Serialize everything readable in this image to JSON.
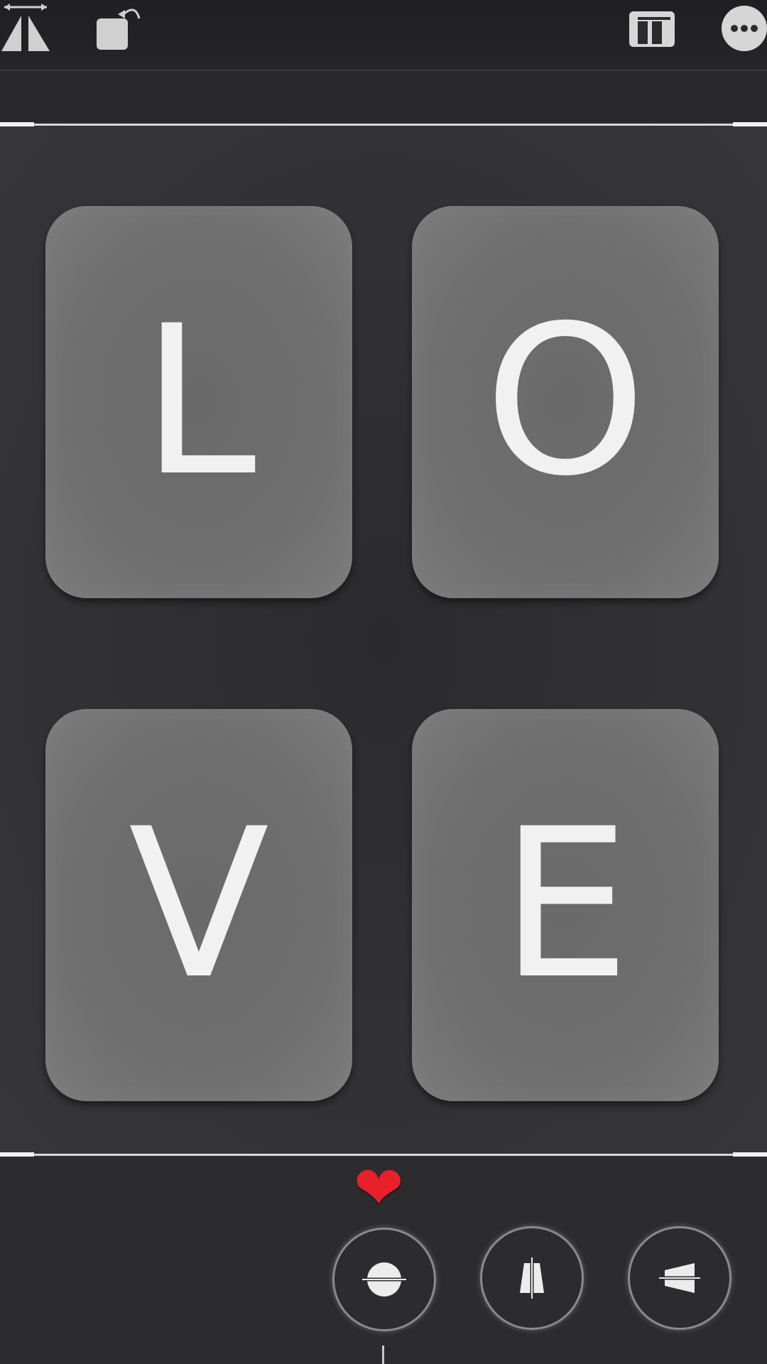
{
  "toolbar": {
    "left_tools": [
      {
        "icon": "flip-horizontal-icon"
      },
      {
        "icon": "rotate-icon"
      }
    ],
    "right_tools": [
      {
        "icon": "aspect-ratio-icon"
      },
      {
        "icon": "more-options-icon"
      }
    ]
  },
  "tiles": [
    {
      "letter": "L"
    },
    {
      "letter": "O"
    },
    {
      "letter": "V"
    },
    {
      "letter": "E"
    }
  ],
  "sticker": {
    "glyph": "❤"
  },
  "perspective_tools": [
    {
      "icon": "straighten-icon",
      "selected": true
    },
    {
      "icon": "vertical-perspective-icon",
      "selected": false
    },
    {
      "icon": "horizontal-perspective-icon",
      "selected": false
    }
  ],
  "colors": {
    "background": "#2e2e30",
    "tile": "#6e6e6e",
    "letter": "#f1f1f1",
    "heart": "#e8202a"
  }
}
